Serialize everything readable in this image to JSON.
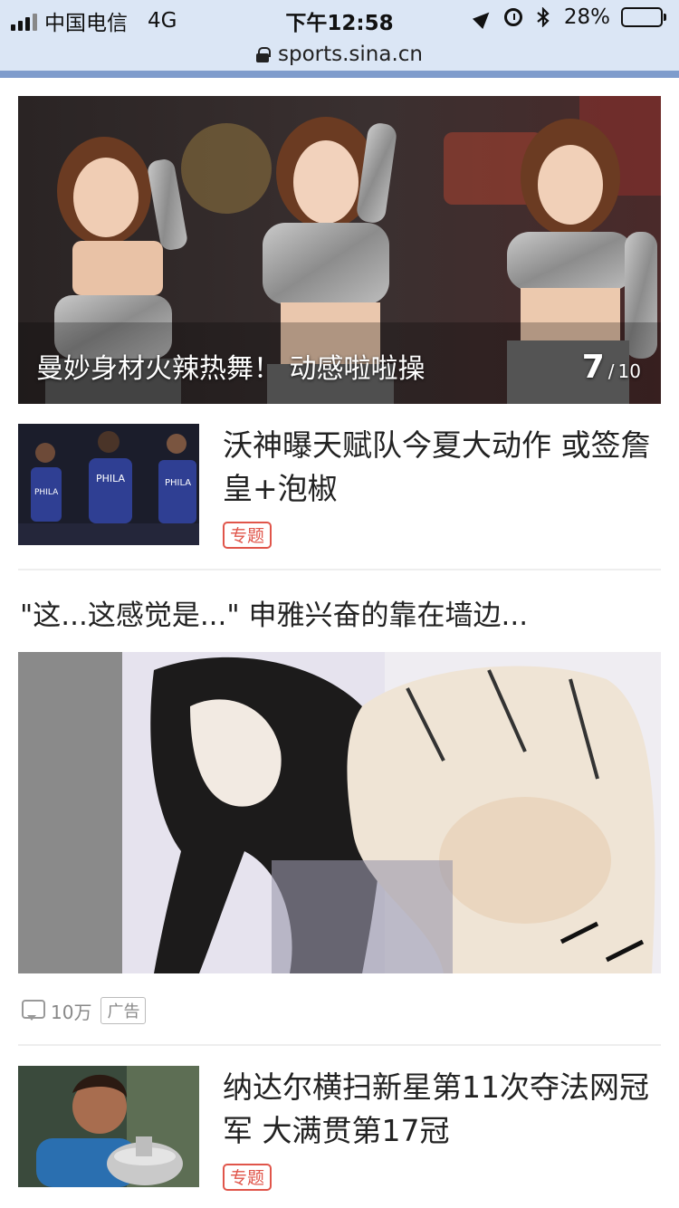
{
  "status_bar": {
    "carrier": "中国电信",
    "network": "4G",
    "time": "下午12:58",
    "battery_percent_text": "28%",
    "battery_level": 0.28,
    "icons": [
      "signal-icon",
      "location-icon",
      "alarm-icon",
      "bluetooth-icon",
      "battery-icon"
    ]
  },
  "url_bar": {
    "url": "sports.sina.cn",
    "icon": "lock-icon"
  },
  "feed": {
    "hero": {
      "caption": "曼妙身材火辣热舞！ 动感啦啦操",
      "counter_current": "7",
      "counter_separator": "/",
      "counter_total": "10"
    },
    "items": [
      {
        "title": "沃神曝天赋队今夏大动作 或签詹皇+泡椒",
        "tag": "专题"
      },
      {
        "title": "纳达尔横扫新星第11次夺法网冠军 大满贯第17冠",
        "tag": "专题"
      }
    ],
    "ad": {
      "title": "\"这...这感觉是...\" 申雅兴奋的靠在墙边...",
      "comment_count": "10万",
      "badge": "广告"
    }
  },
  "colors": {
    "status_bg": "#dbe6f5",
    "url_edge": "#7f9ccc",
    "tag_red": "#e0554a",
    "divider": "#eeeeee"
  }
}
